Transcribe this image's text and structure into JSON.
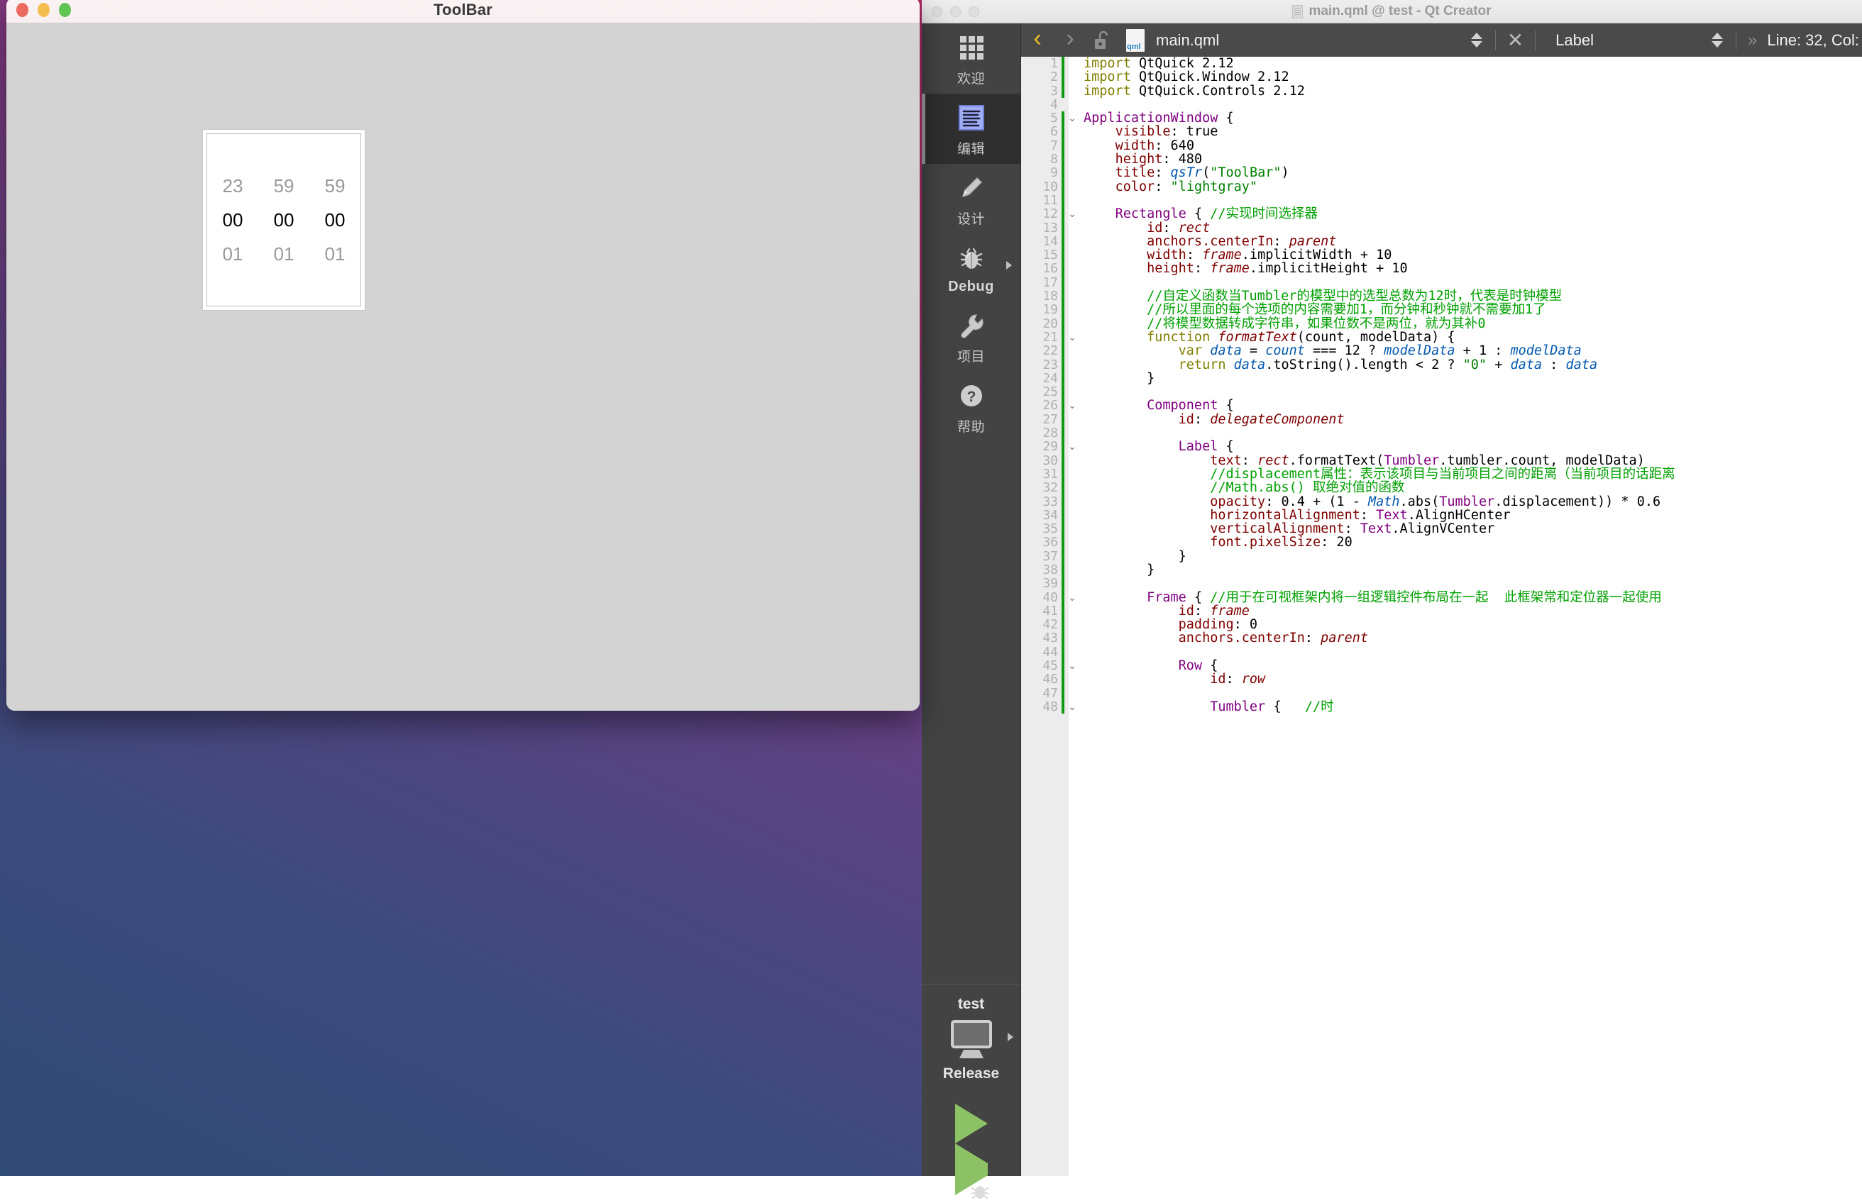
{
  "desktop": {
    "name": "macos-desktop-wallpaper"
  },
  "app_window": {
    "title": "ToolBar",
    "traffic_lights": [
      "close",
      "minimize",
      "zoom"
    ],
    "tumbler": {
      "columns": [
        {
          "name": "hours",
          "above": "23",
          "selected": "00",
          "below": "01"
        },
        {
          "name": "minutes",
          "above": "59",
          "selected": "00",
          "below": "01"
        },
        {
          "name": "seconds",
          "above": "59",
          "selected": "00",
          "below": "01"
        }
      ]
    }
  },
  "ide": {
    "window_title": "main.qml @ test - Qt Creator",
    "sidebar": {
      "modes": [
        {
          "label": "欢迎",
          "icon": "grid-icon",
          "selected": false,
          "has_arrow": false,
          "en": false
        },
        {
          "label": "编辑",
          "icon": "document-icon",
          "selected": true,
          "has_arrow": false,
          "en": false
        },
        {
          "label": "设计",
          "icon": "pencil-icon",
          "selected": false,
          "has_arrow": false,
          "en": false
        },
        {
          "label": "Debug",
          "icon": "bug-icon",
          "selected": false,
          "has_arrow": true,
          "en": true
        },
        {
          "label": "项目",
          "icon": "wrench-icon",
          "selected": false,
          "has_arrow": false,
          "en": false
        },
        {
          "label": "帮助",
          "icon": "help-icon",
          "selected": false,
          "has_arrow": false,
          "en": false
        }
      ],
      "kit": {
        "project": "test",
        "build_config": "Release"
      },
      "actions": [
        "run",
        "debug"
      ]
    },
    "toolbar": {
      "back": "‹",
      "forward": "›",
      "lock_state": "unlocked",
      "filename": "main.qml",
      "close_label": "✕",
      "symbol": "Label",
      "overflow": "»",
      "cursor_position": "Line: 32, Col:"
    },
    "editor": {
      "lines": [
        {
          "n": 1,
          "chg": true,
          "fold": "",
          "html": "<span class='k'>import</span> QtQuick 2.12"
        },
        {
          "n": 2,
          "chg": true,
          "fold": "",
          "html": "<span class='k'>import</span> QtQuick.Window 2.12"
        },
        {
          "n": 3,
          "chg": true,
          "fold": "",
          "html": "<span class='k'>import</span> QtQuick.Controls 2.12"
        },
        {
          "n": 4,
          "chg": false,
          "fold": "",
          "html": ""
        },
        {
          "n": 5,
          "chg": true,
          "fold": "v",
          "html": "<span class='typ'>ApplicationWindow</span> {"
        },
        {
          "n": 6,
          "chg": true,
          "fold": "",
          "html": "    <span class='prop'>visible</span>: true"
        },
        {
          "n": 7,
          "chg": true,
          "fold": "",
          "html": "    <span class='prop'>width</span>: 640"
        },
        {
          "n": 8,
          "chg": true,
          "fold": "",
          "html": "    <span class='prop'>height</span>: 480"
        },
        {
          "n": 9,
          "chg": true,
          "fold": "",
          "html": "    <span class='prop'>title</span>: <span class='var'>qsTr</span>(<span class='str'>\"ToolBar\"</span>)"
        },
        {
          "n": 10,
          "chg": true,
          "fold": "",
          "html": "    <span class='prop'>color</span>: <span class='str'>\"lightgray\"</span>"
        },
        {
          "n": 11,
          "chg": true,
          "fold": "",
          "html": ""
        },
        {
          "n": 12,
          "chg": true,
          "fold": "v",
          "html": "    <span class='typ'>Rectangle</span> { <span class='cmt'>//实现时间选择器</span>"
        },
        {
          "n": 13,
          "chg": true,
          "fold": "",
          "html": "        <span class='prop'>id</span>: <span class='id'>rect</span>"
        },
        {
          "n": 14,
          "chg": true,
          "fold": "",
          "html": "        <span class='prop'>anchors.centerIn</span>: <span class='id'>parent</span>"
        },
        {
          "n": 15,
          "chg": true,
          "fold": "",
          "html": "        <span class='prop'>width</span>: <span class='id'>frame</span>.implicitWidth + 10"
        },
        {
          "n": 16,
          "chg": true,
          "fold": "",
          "html": "        <span class='prop'>height</span>: <span class='id'>frame</span>.implicitHeight + 10"
        },
        {
          "n": 17,
          "chg": true,
          "fold": "",
          "html": ""
        },
        {
          "n": 18,
          "chg": true,
          "fold": "",
          "html": "        <span class='cmt'>//自定义函数当Tumbler的模型中的选型总数为12时，代表是时钟模型</span>"
        },
        {
          "n": 19,
          "chg": true,
          "fold": "",
          "html": "        <span class='cmt'>//所以里面的每个选项的内容需要加1，而分钟和秒钟就不需要加1了</span>"
        },
        {
          "n": 20,
          "chg": true,
          "fold": "",
          "html": "        <span class='cmt'>//将模型数据转成字符串，如果位数不是两位，就为其补0</span>"
        },
        {
          "n": 21,
          "chg": true,
          "fold": "v",
          "html": "        <span class='k'>function</span> <span class='id'>formatText</span>(count, modelData) {"
        },
        {
          "n": 22,
          "chg": true,
          "fold": "",
          "html": "            <span class='k'>var</span> <span class='var'>data</span> = <span class='var'>count</span> === 12 ? <span class='var'>modelData</span> + 1 : <span class='var'>modelData</span>"
        },
        {
          "n": 23,
          "chg": true,
          "fold": "",
          "html": "            <span class='k'>return</span> <span class='var'>data</span>.toString().length &lt; 2 ? <span class='str'>\"0\"</span> + <span class='var'>data</span> : <span class='var'>data</span>"
        },
        {
          "n": 24,
          "chg": true,
          "fold": "",
          "html": "        }"
        },
        {
          "n": 25,
          "chg": true,
          "fold": "",
          "html": ""
        },
        {
          "n": 26,
          "chg": true,
          "fold": "v",
          "html": "        <span class='typ'>Component</span> {"
        },
        {
          "n": 27,
          "chg": true,
          "fold": "",
          "html": "            <span class='prop'>id</span>: <span class='id'>delegateComponent</span>"
        },
        {
          "n": 28,
          "chg": true,
          "fold": "",
          "html": ""
        },
        {
          "n": 29,
          "chg": true,
          "fold": "v",
          "html": "            <span class='typ'>Label</span> {"
        },
        {
          "n": 30,
          "chg": true,
          "fold": "",
          "html": "                <span class='prop'>text</span>: <span class='id'>rect</span>.formatText(<span class='typ'>Tumbler</span>.tumbler.count, modelData)"
        },
        {
          "n": 31,
          "chg": true,
          "fold": "",
          "html": "                <span class='cmt'>//displacement属性：表示该项目与当前项目之间的距离（当前项目的话距离</span>"
        },
        {
          "n": 32,
          "chg": true,
          "fold": "",
          "html": "                <span class='cmt'>//Math.abs() 取绝对值的函数</span>"
        },
        {
          "n": 33,
          "chg": true,
          "fold": "",
          "html": "                <span class='prop'>opacity</span>: 0.4 + (1 - <span class='var'>Math</span>.abs(<span class='typ'>Tumbler</span>.displacement)) * 0.6"
        },
        {
          "n": 34,
          "chg": true,
          "fold": "",
          "html": "                <span class='prop'>horizontalAlignment</span>: <span class='typ'>Text</span>.AlignHCenter"
        },
        {
          "n": 35,
          "chg": true,
          "fold": "",
          "html": "                <span class='prop'>verticalAlignment</span>: <span class='typ'>Text</span>.AlignVCenter"
        },
        {
          "n": 36,
          "chg": true,
          "fold": "",
          "html": "                <span class='prop'>font.pixelSize</span>: 20"
        },
        {
          "n": 37,
          "chg": true,
          "fold": "",
          "html": "            }"
        },
        {
          "n": 38,
          "chg": true,
          "fold": "",
          "html": "        }"
        },
        {
          "n": 39,
          "chg": true,
          "fold": "",
          "html": ""
        },
        {
          "n": 40,
          "chg": true,
          "fold": "v",
          "html": "        <span class='typ'>Frame</span> { <span class='cmt'>//用于在可视框架内将一组逻辑控件布局在一起  此框架常和定位器一起使用</span>"
        },
        {
          "n": 41,
          "chg": true,
          "fold": "",
          "html": "            <span class='prop'>id</span>: <span class='id'>frame</span>"
        },
        {
          "n": 42,
          "chg": true,
          "fold": "",
          "html": "            <span class='prop'>padding</span>: 0"
        },
        {
          "n": 43,
          "chg": true,
          "fold": "",
          "html": "            <span class='prop'>anchors.centerIn</span>: <span class='id'>parent</span>"
        },
        {
          "n": 44,
          "chg": true,
          "fold": "",
          "html": ""
        },
        {
          "n": 45,
          "chg": true,
          "fold": "v",
          "html": "            <span class='typ'>Row</span> {"
        },
        {
          "n": 46,
          "chg": true,
          "fold": "",
          "html": "                <span class='prop'>id</span>: <span class='id'>row</span>"
        },
        {
          "n": 47,
          "chg": true,
          "fold": "",
          "html": ""
        },
        {
          "n": 48,
          "chg": true,
          "fold": "v",
          "html": "                <span class='typ'>Tumbler</span> {   <span class='cmt'>//时</span>"
        }
      ]
    }
  }
}
